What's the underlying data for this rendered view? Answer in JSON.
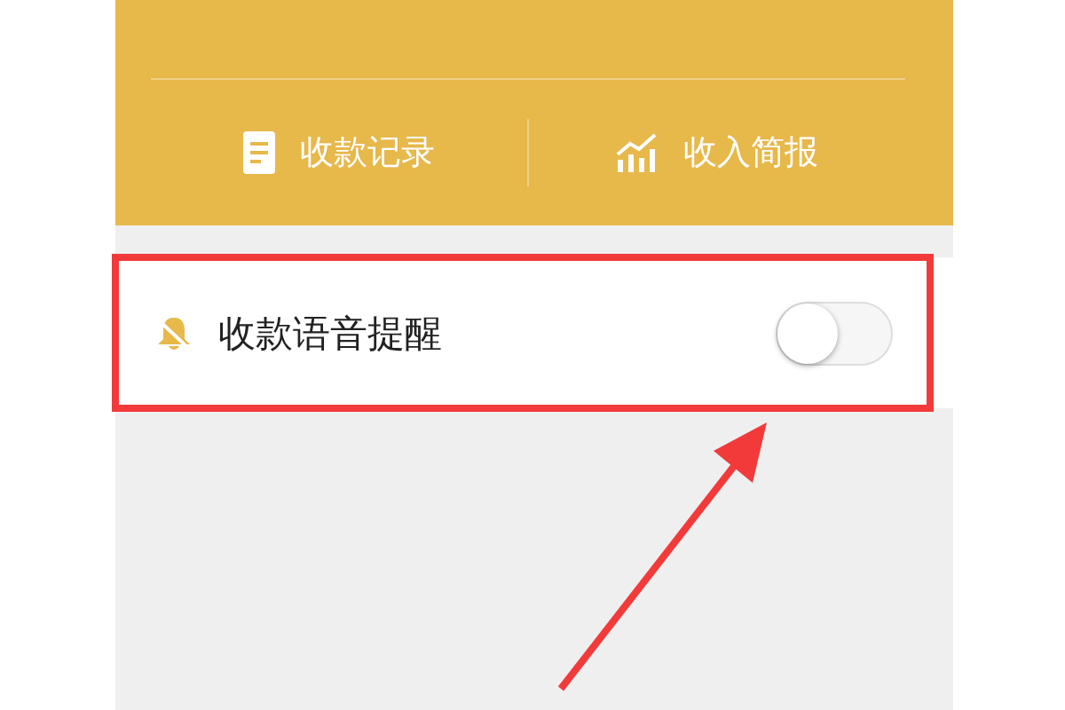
{
  "header": {
    "actions": [
      {
        "label": "收款记录",
        "kind": "records"
      },
      {
        "label": "收入简报",
        "kind": "report"
      }
    ]
  },
  "settings": [
    {
      "label": "收款语音提醒",
      "on": false,
      "highlighted": true
    }
  ]
}
